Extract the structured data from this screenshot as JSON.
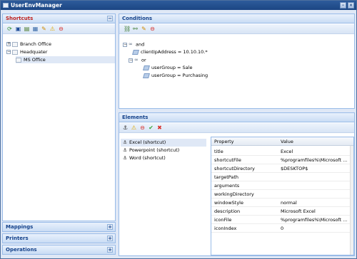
{
  "app": {
    "title": "UserEnvManager"
  },
  "shortcuts": {
    "title": "Shortcuts",
    "collapse": "−",
    "tree": [
      {
        "label": "Branch Office"
      },
      {
        "label": "Headquater"
      },
      {
        "label": "MS Office"
      }
    ]
  },
  "accordion": {
    "mappings": "Mappings",
    "printers": "Printers",
    "operations": "Operations",
    "expand": "+"
  },
  "conditions": {
    "title": "Conditions",
    "tree": [
      {
        "label": "and"
      },
      {
        "label": "clientIpAddress = 10.10.10.*"
      },
      {
        "label": "or"
      },
      {
        "label": "userGroup = Sale"
      },
      {
        "label": "userGroup = Purchasing"
      }
    ]
  },
  "elements": {
    "title": "Elements",
    "items": [
      {
        "label": "Excel (shortcut)"
      },
      {
        "label": "Powerpoint (shortcut)"
      },
      {
        "label": "Word (shortcut)"
      }
    ],
    "grid": {
      "col_property": "Property",
      "col_value": "Value",
      "rows": [
        {
          "property": "title",
          "value": "Excel"
        },
        {
          "property": "shortcutFile",
          "value": "%programfiles%\\Microsoft ..."
        },
        {
          "property": "shortcutDirectory",
          "value": "$DESKTOP$"
        },
        {
          "property": "targetPath",
          "value": ""
        },
        {
          "property": "arguments",
          "value": ""
        },
        {
          "property": "workingDirectory",
          "value": ""
        },
        {
          "property": "windowStyle",
          "value": "normal"
        },
        {
          "property": "description",
          "value": "Microsoft Excel"
        },
        {
          "property": "iconFile",
          "value": "%programfiles%\\Microsoft ..."
        },
        {
          "property": "iconIndex",
          "value": "0"
        }
      ]
    }
  }
}
